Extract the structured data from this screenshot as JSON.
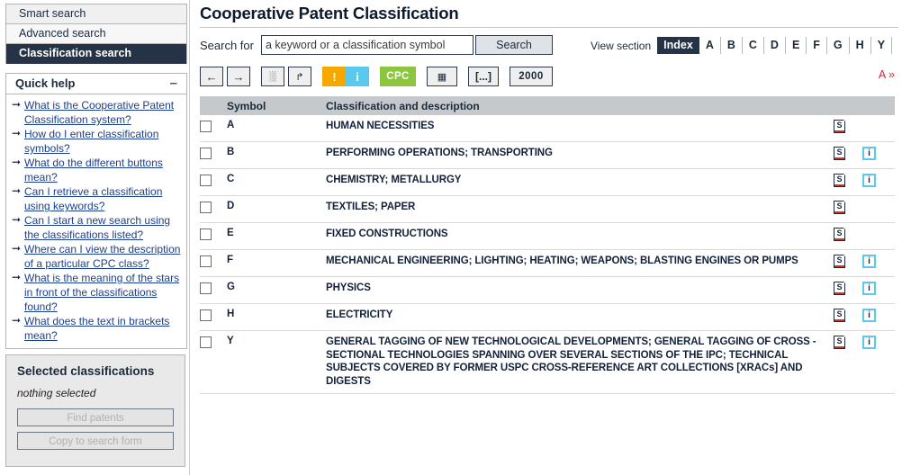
{
  "sidebar": {
    "tabs": [
      {
        "label": "Smart search",
        "active": false
      },
      {
        "label": "Advanced search",
        "active": false
      },
      {
        "label": "Classification search",
        "active": true
      }
    ],
    "quick_help": {
      "title": "Quick help",
      "collapse_glyph": "–",
      "items": [
        "What is the Cooperative Patent Classification system?",
        "How do I enter classification symbols?",
        "What do the different buttons mean?",
        "Can I retrieve a classification using keywords?",
        "Can I start a new search using the classifications listed?",
        "Where can I view the description of a particular CPC class?",
        "What is the meaning of the stars in front of the classifications found?",
        "What does the text in brackets mean?"
      ]
    },
    "selected": {
      "title": "Selected classifications",
      "empty_text": "nothing selected",
      "find_patents_label": "Find patents",
      "copy_label": "Copy to search form"
    }
  },
  "main": {
    "title": "Cooperative Patent Classification",
    "search": {
      "label": "Search for",
      "placeholder": "a keyword or a classification symbol",
      "value": "",
      "button_label": "Search"
    },
    "view_section": {
      "label": "View section",
      "index_label": "Index",
      "letters": [
        "A",
        "B",
        "C",
        "D",
        "E",
        "F",
        "G",
        "H",
        "Y"
      ]
    },
    "toolbar": {
      "more_label": "A »",
      "buttons": [
        {
          "name": "back-button",
          "glyph": "←",
          "style": "plain"
        },
        {
          "name": "forward-button",
          "glyph": "→",
          "style": "plain-gap"
        },
        {
          "name": "expand-tree-button",
          "glyph": "░",
          "style": "plain"
        },
        {
          "name": "collapse-tree-button",
          "glyph": "↱",
          "style": "plain-gap"
        },
        {
          "name": "warning-button",
          "glyph": "!",
          "style": "orange"
        },
        {
          "name": "info-button",
          "glyph": "i",
          "style": "cyan-gap"
        },
        {
          "name": "cpc-button",
          "glyph": "CPC",
          "style": "green"
        },
        {
          "name": "table-view-button",
          "glyph": "▦",
          "style": "plain"
        },
        {
          "name": "brackets-button",
          "glyph": "[...]",
          "style": "brackets"
        },
        {
          "name": "year-2000-button",
          "glyph": "2000",
          "style": "num"
        }
      ]
    },
    "table": {
      "headers": {
        "checkbox": "",
        "symbol": "Symbol",
        "description": "Classification and description",
        "icon1": "",
        "icon2": ""
      },
      "rows": [
        {
          "symbol": "A",
          "description": "HUMAN NECESSITIES",
          "s_icon": "s-document-icon",
          "i_icon": null
        },
        {
          "symbol": "B",
          "description": "PERFORMING OPERATIONS; TRANSPORTING",
          "s_icon": "s-document-icon",
          "i_icon": "info-icon"
        },
        {
          "symbol": "C",
          "description": "CHEMISTRY; METALLURGY",
          "s_icon": "s-document-icon",
          "i_icon": "info-icon"
        },
        {
          "symbol": "D",
          "description": "TEXTILES; PAPER",
          "s_icon": "s-document-icon",
          "i_icon": null
        },
        {
          "symbol": "E",
          "description": "FIXED CONSTRUCTIONS",
          "s_icon": "s-document-icon",
          "i_icon": null
        },
        {
          "symbol": "F",
          "description": "MECHANICAL ENGINEERING; LIGHTING; HEATING; WEAPONS; BLASTING ENGINES OR PUMPS",
          "s_icon": "s-document-icon",
          "i_icon": "info-icon"
        },
        {
          "symbol": "G",
          "description": "PHYSICS",
          "s_icon": "s-document-icon",
          "i_icon": "info-icon"
        },
        {
          "symbol": "H",
          "description": "ELECTRICITY",
          "s_icon": "s-document-icon",
          "i_icon": "info-icon"
        },
        {
          "symbol": "Y",
          "description": "GENERAL TAGGING OF NEW TECHNOLOGICAL DEVELOPMENTS; GENERAL TAGGING OF CROSS -SECTIONAL TECHNOLOGIES SPANNING OVER SEVERAL SECTIONS OF THE IPC; TECHNICAL SUBJECTS COVERED BY FORMER USPC CROSS-REFERENCE ART COLLECTIONS [XRACs] AND DIGESTS",
          "s_icon": "s-document-icon",
          "i_icon": "info-icon"
        }
      ]
    }
  },
  "colors": {
    "accent_dark": "#263246",
    "symbol_red": "#cc2200",
    "link_blue": "#1b3f8f",
    "orange": "#f5a800",
    "cyan": "#5bc8ee",
    "green": "#8cc63e",
    "header_gray": "#c6c9cc"
  }
}
